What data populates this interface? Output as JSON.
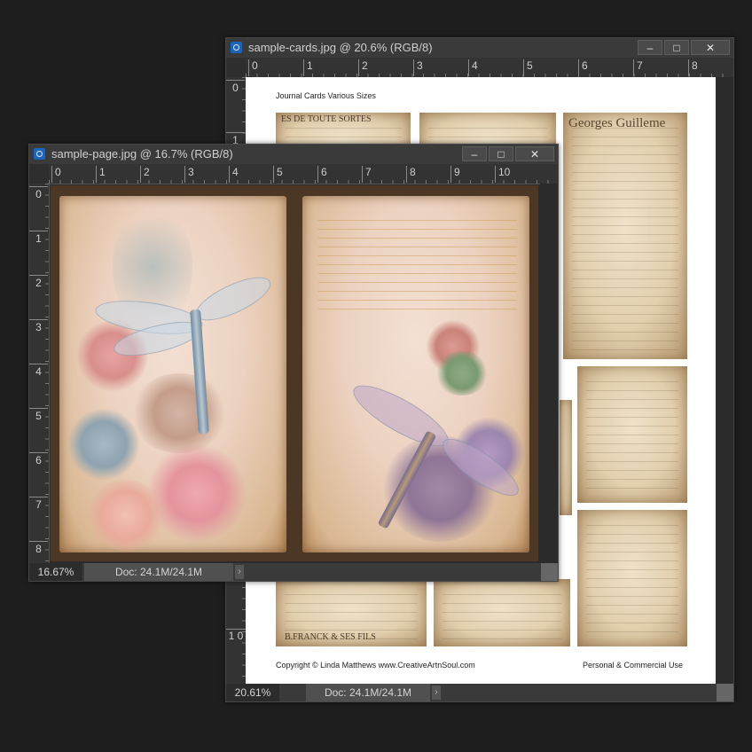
{
  "windows": {
    "cards": {
      "title": "sample-cards.jpg @ 20.6% (RGB/8)",
      "ruler_h": [
        "0",
        "1",
        "2",
        "3",
        "4",
        "5",
        "6",
        "7",
        "8"
      ],
      "ruler_v": [
        "0",
        "1",
        "1 0"
      ],
      "zoom": "20.61%",
      "doc_info": "Doc: 24.1M/24.1M",
      "document": {
        "heading": "Journal Cards Various Sizes",
        "copyright": "Copyright © Linda Matthews www.CreativeArtnSoul.com",
        "usage": "Personal & Commercial Use",
        "card_texts": {
          "toute": "ES DE TOUTE SORTES",
          "georges": "Georges Guilleme",
          "franck": "B.FRANCK & SES FILS"
        }
      }
    },
    "page": {
      "title": "sample-page.jpg @ 16.7% (RGB/8)",
      "ruler_h": [
        "0",
        "1",
        "2",
        "3",
        "4",
        "5",
        "6",
        "7",
        "8",
        "9",
        "10"
      ],
      "ruler_v": [
        "0",
        "1",
        "2",
        "3",
        "4",
        "5",
        "6",
        "7",
        "8"
      ],
      "zoom": "16.67%",
      "doc_info": "Doc: 24.1M/24.1M"
    }
  },
  "window_buttons": {
    "minimize": "–",
    "maximize": "□",
    "close": "✕"
  },
  "icons": [
    "photoshop-doc-icon",
    "minimize-icon",
    "maximize-icon",
    "close-icon",
    "chevron-right-icon"
  ]
}
